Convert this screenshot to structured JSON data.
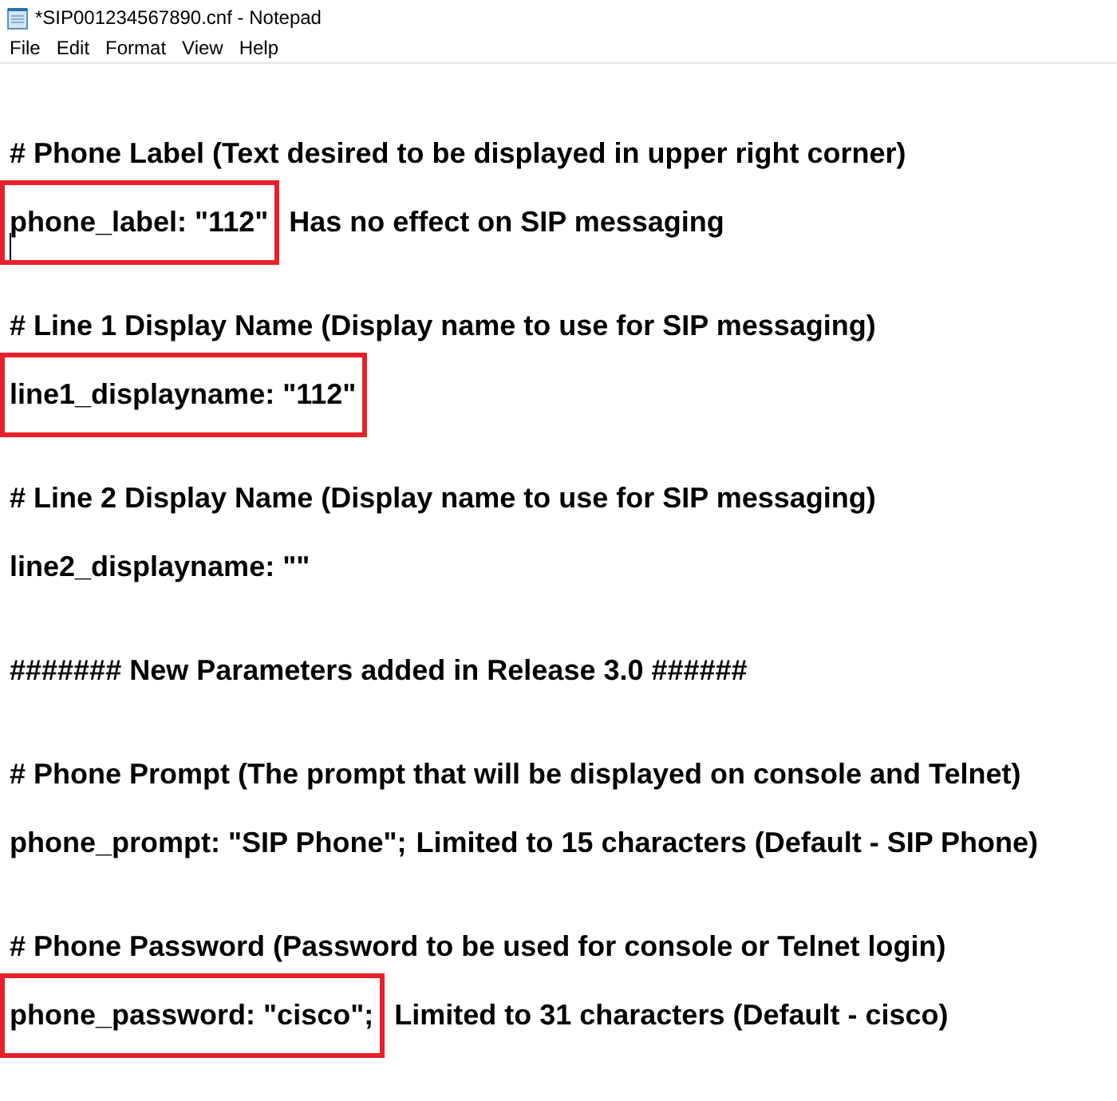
{
  "window": {
    "title": "*SIP001234567890.cnf - Notepad"
  },
  "menu": [
    "File",
    "Edit",
    "Format",
    "View",
    "Help"
  ],
  "lines": [
    {
      "kind": "comment",
      "text": "# Phone Label (Text desired to be displayed in upper right corner)"
    },
    {
      "kind": "setting",
      "code": "phone_label: \"112\"",
      "note": "Has no effect on SIP messaging",
      "highlighted": true,
      "cursor": true
    },
    {
      "kind": "comment",
      "text": "# Line 1 Display Name (Display name to use for SIP messaging)"
    },
    {
      "kind": "setting",
      "code": "line1_displayname: \"112\"",
      "highlighted": true,
      "cursor": false
    },
    {
      "kind": "comment",
      "text": "# Line 2 Display Name (Display name to use for SIP messaging)"
    },
    {
      "kind": "setting",
      "code": "line2_displayname: \"\"",
      "highlighted": false,
      "cursor": false
    },
    {
      "kind": "comment",
      "text": "####### New Parameters added in Release 3.0 ######"
    },
    {
      "kind": "comment",
      "text": "# Phone Prompt (The prompt that will be displayed on console and Telnet)"
    },
    {
      "kind": "setting",
      "code": "phone_prompt: \"SIP Phone\";",
      "note": "Limited to 15 characters (Default - SIP Phone)",
      "highlighted": false,
      "cursor": false
    },
    {
      "kind": "comment",
      "text": "# Phone Password (Password to be used for console or Telnet login)"
    },
    {
      "kind": "setting",
      "code": "phone_password: \"cisco\";",
      "note": "Limited to 31 characters (Default - cisco)",
      "highlighted": true,
      "cursor": false
    }
  ]
}
